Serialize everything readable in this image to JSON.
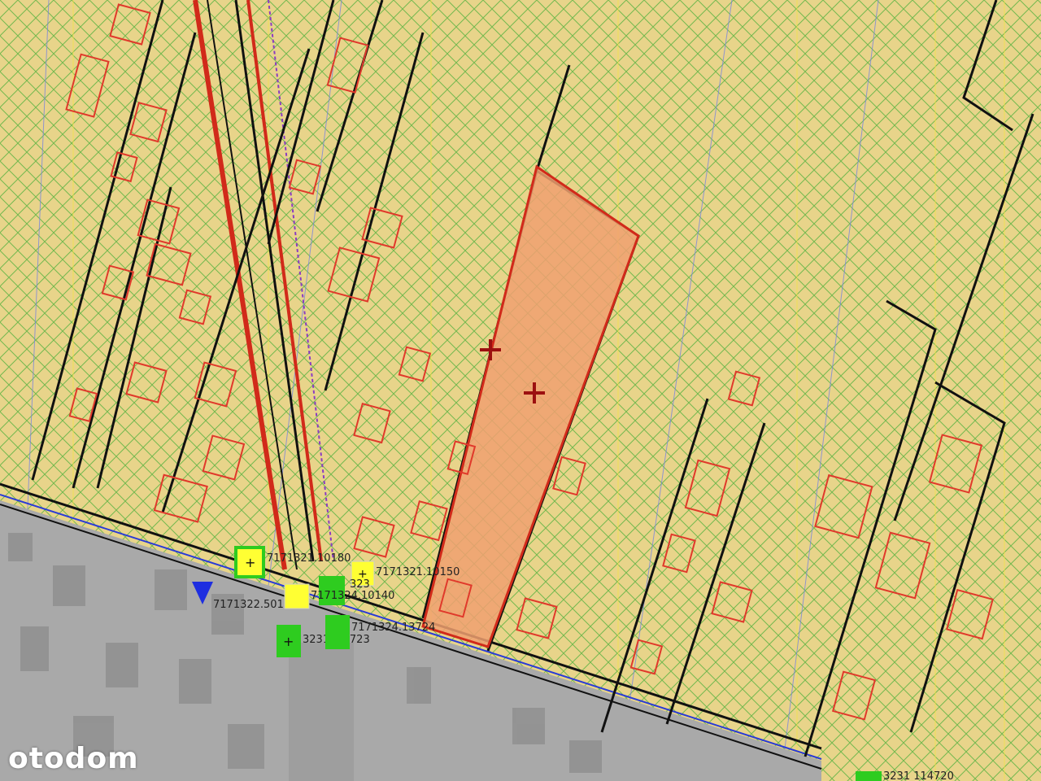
{
  "map": {
    "colors": {
      "land": "#e8d48a",
      "hatch": "#4caf3a",
      "grid_yellow": "#f2e34a",
      "grid_blue": "#7a86e0",
      "boundary": "#111111",
      "building": "#e0392b",
      "highlight_fill": "#f0a070",
      "highlight_edge": "#d12a1a",
      "road": "#a9a9a9",
      "marker_green": "#2ecc1f",
      "marker_yellow": "#ffff33"
    },
    "markers": [
      {
        "type": "yellow-square",
        "label": "7171321.10180"
      },
      {
        "type": "yellow-square",
        "label": "7171321.10150"
      },
      {
        "type": "blue-triangle",
        "label": "7171322.5010"
      },
      {
        "type": "yellow-square",
        "label": "323"
      },
      {
        "type": "green-square",
        "label": "7171324.10140"
      },
      {
        "type": "green-square",
        "label": "3231113723"
      },
      {
        "type": "green-square",
        "label": "7171324.13724"
      },
      {
        "type": "green-square",
        "label": "3231 114720"
      }
    ]
  },
  "watermark": "otodom"
}
